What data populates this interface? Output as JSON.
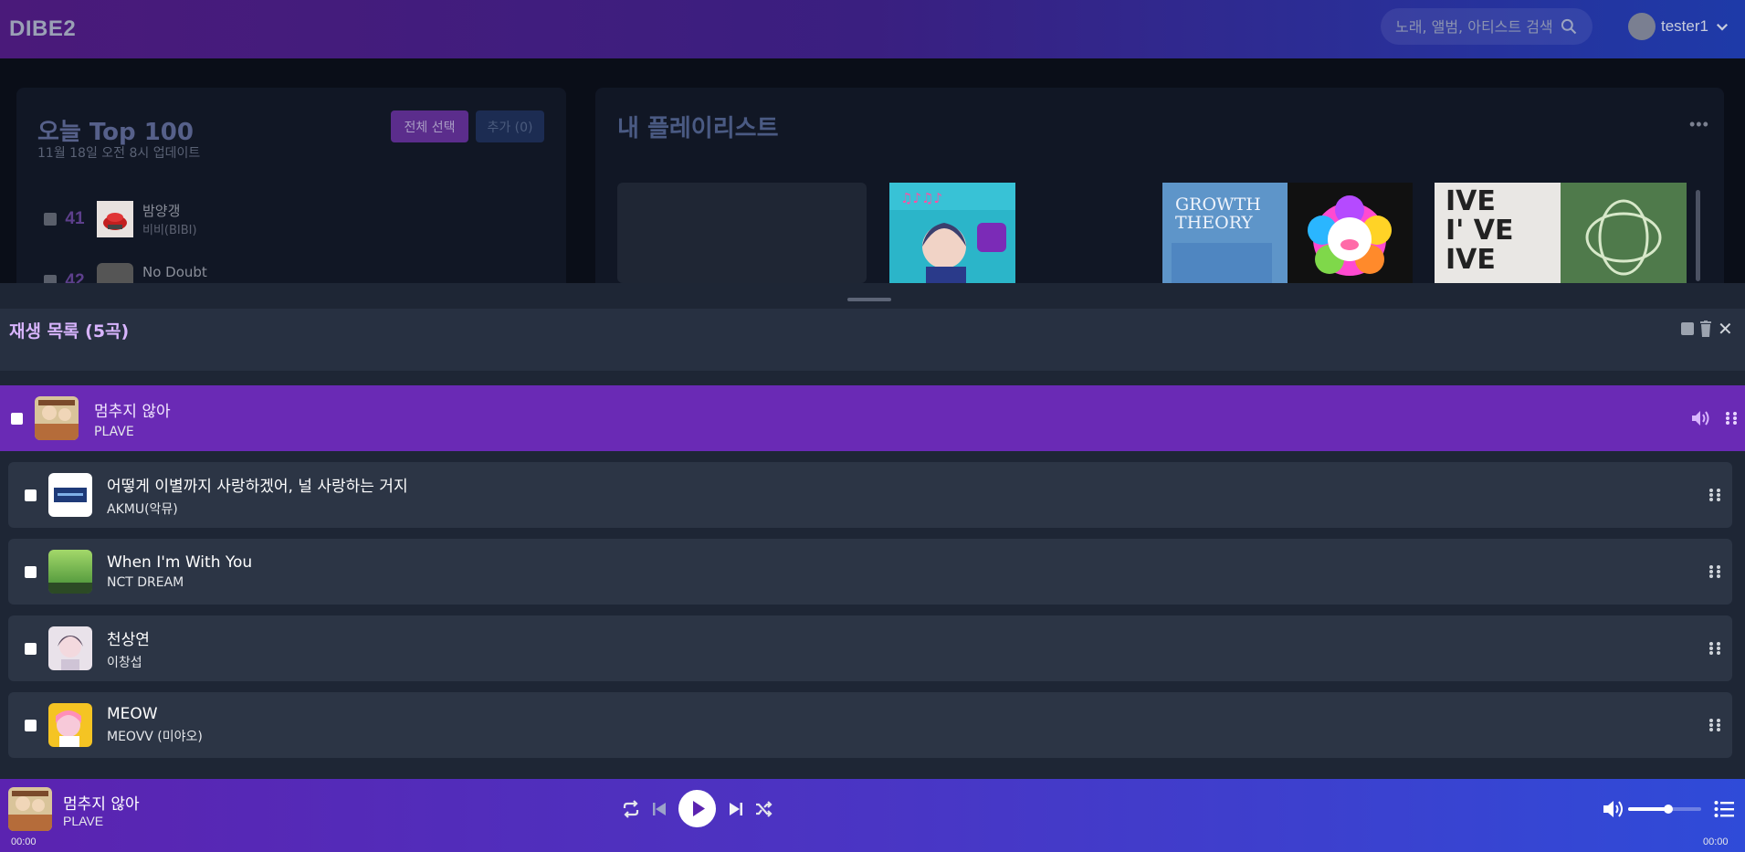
{
  "header": {
    "logo": "DIBE2",
    "search_placeholder": "노래, 앨범, 아티스트 검색",
    "username": "tester1"
  },
  "chart": {
    "title": "오늘 Top 100",
    "updated": "11월 18일 오전 8시 업데이트",
    "select_all": "전체 선택",
    "add": "추가 (0)",
    "rows": [
      {
        "rank": "41",
        "title": "밤양갱",
        "artist": "비비(BIBI)"
      },
      {
        "rank": "42",
        "title": "No Doubt",
        "artist": ""
      }
    ]
  },
  "playlists": {
    "title": "내 플레이리스트",
    "more": "•••"
  },
  "queue": {
    "title": "재생 목록 (5곡)",
    "current": {
      "title": "멈추지 않아",
      "artist": "PLAVE"
    },
    "items": [
      {
        "title": "어떻게 이별까지 사랑하겠어, 널 사랑하는 거지",
        "artist": "AKMU(악뮤)"
      },
      {
        "title": "When I'm With You",
        "artist": "NCT DREAM"
      },
      {
        "title": "천상연",
        "artist": "이창섭"
      },
      {
        "title": "MEOW",
        "artist": "MEOVV (미야오)"
      }
    ]
  },
  "player": {
    "title": "멈추지 않아",
    "artist": "PLAVE",
    "elapsed": "00:00",
    "duration": "00:00",
    "volume_fraction": 0.55
  },
  "colors": {
    "accent": "#6a2ab5",
    "header_start": "#4a1a7a",
    "header_end": "#1e3aa8",
    "queue_title": "#d8b4fe"
  }
}
